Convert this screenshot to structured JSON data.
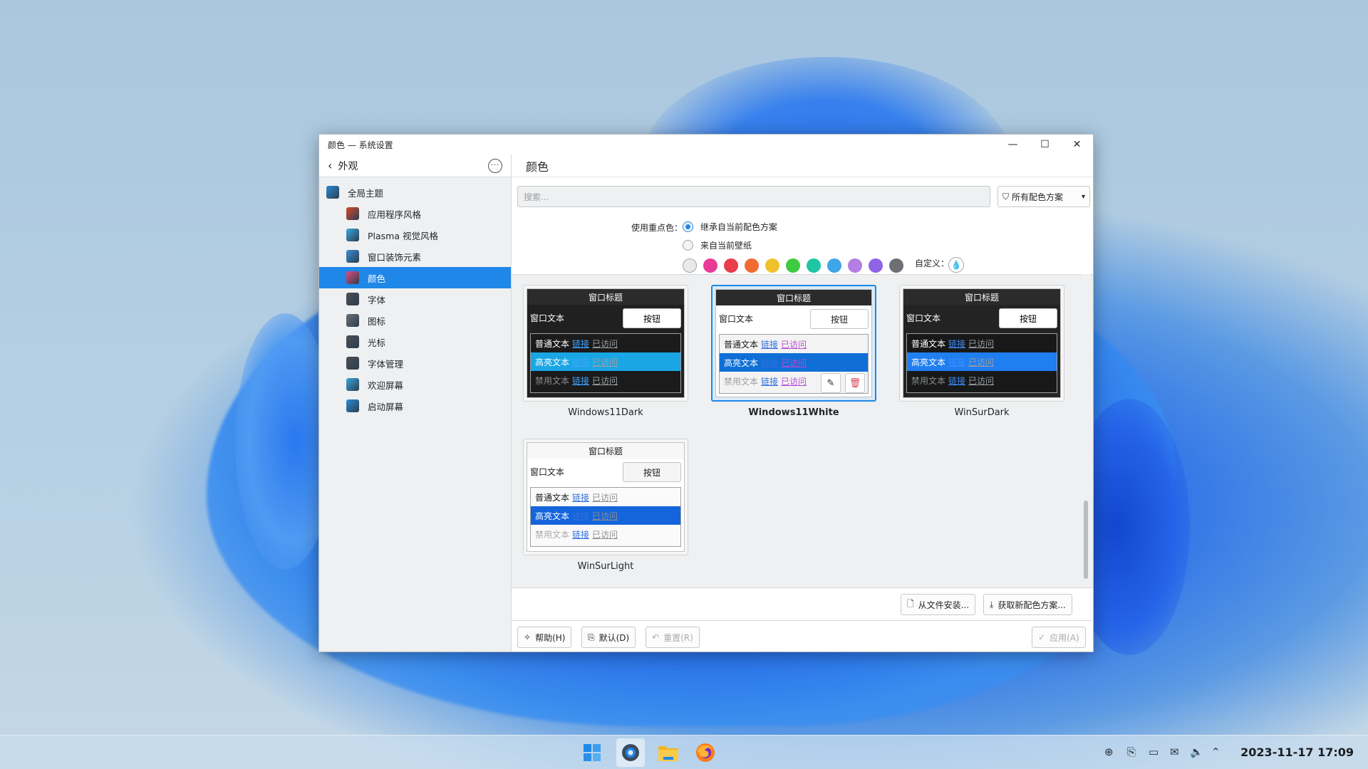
{
  "window": {
    "title": "颜色 — 系统设置",
    "controls": {
      "minimize": "—",
      "maximize": "☐",
      "close": "✕"
    }
  },
  "sidebar": {
    "back_label": "外观",
    "items": [
      {
        "label": "全局主题",
        "icon": "global-theme-icon",
        "color": "#2a8bd6"
      },
      {
        "label": "应用程序风格",
        "icon": "app-style-icon",
        "color": "#d9482b"
      },
      {
        "label": "Plasma 视觉风格",
        "icon": "plasma-style-icon",
        "color": "#3ba7e0"
      },
      {
        "label": "窗口装饰元素",
        "icon": "window-decoration-icon",
        "color": "#3c8fd8"
      },
      {
        "label": "颜色",
        "icon": "colors-icon",
        "color": "#e24a7c"
      },
      {
        "label": "字体",
        "icon": "fonts-icon",
        "color": "#4d4f52"
      },
      {
        "label": "图标",
        "icon": "icons-icon",
        "color": "#6b6f73"
      },
      {
        "label": "光标",
        "icon": "cursor-icon",
        "color": "#4d4f52"
      },
      {
        "label": "字体管理",
        "icon": "font-management-icon",
        "color": "#4d4f52"
      },
      {
        "label": "欢迎屏幕",
        "icon": "splash-screen-icon",
        "color": "#3ba7e0"
      },
      {
        "label": "启动屏幕",
        "icon": "login-screen-icon",
        "color": "#2a8bd6"
      }
    ]
  },
  "main": {
    "title": "颜色",
    "search_placeholder": "搜索...",
    "filter_label": "所有配色方案",
    "accent_label": "使用重点色：",
    "accent_options": [
      "继承自当前配色方案",
      "来自当前壁纸"
    ],
    "custom_label": "自定义：",
    "swatches": [
      "#e8e9ea",
      "#e93a96",
      "#e93c4c",
      "#f06a31",
      "#efc22b",
      "#3fcb41",
      "#1dc7a5",
      "#3ea5e8",
      "#b47ee3",
      "#8f63e6",
      "#6d6f72"
    ]
  },
  "schemes": [
    {
      "name": "Windows11Dark",
      "title": "窗口标题",
      "window_text": "窗口文本",
      "button": "按钮",
      "normal": "普通文本",
      "link": "链接",
      "visited": "已访问",
      "highlight": "高亮文本",
      "disabled": "禁用文本",
      "colors": {
        "title_bg": "#2b2b2b",
        "title_fg": "#ffffff",
        "win_bg": "#202020",
        "win_fg": "#ffffff",
        "btn_bg": "#ffffff",
        "btn_fg": "#000000",
        "view_bg": "#1b1b1b",
        "view_fg": "#ffffff",
        "hl_bg": "#1aa6e4",
        "hl_fg": "#ffffff",
        "link": "#3ea5ff",
        "visited": "#9aa0a6",
        "dis": "#8a8e92"
      }
    },
    {
      "name": "Windows11White",
      "title": "窗口标题",
      "window_text": "窗口文本",
      "button": "按钮",
      "normal": "普通文本",
      "link": "链接",
      "visited": "已访问",
      "highlight": "高亮文本",
      "disabled": "禁用文本",
      "colors": {
        "title_bg": "#2b2b2b",
        "title_fg": "#ffffff",
        "win_bg": "#ffffff",
        "win_fg": "#1a1a1a",
        "btn_bg": "#ffffff",
        "btn_fg": "#1a1a1a",
        "view_bg": "#f3f3f3",
        "view_fg": "#1a1a1a",
        "hl_bg": "#0f6fd6",
        "hl_fg": "#ffffff",
        "link": "#2f6fdc",
        "visited": "#b64bd6",
        "dis": "#9a9ea2"
      }
    },
    {
      "name": "WinSurDark",
      "title": "窗口标题",
      "window_text": "窗口文本",
      "button": "按钮",
      "normal": "普通文本",
      "link": "链接",
      "visited": "已访问",
      "highlight": "高亮文本",
      "disabled": "禁用文本",
      "colors": {
        "title_bg": "#2b2b2b",
        "title_fg": "#ffffff",
        "win_bg": "#232323",
        "win_fg": "#ffffff",
        "btn_bg": "#ffffff",
        "btn_fg": "#000000",
        "view_bg": "#181818",
        "view_fg": "#ffffff",
        "hl_bg": "#1f7ef0",
        "hl_fg": "#ffffff",
        "link": "#3e8dff",
        "visited": "#9aa0a6",
        "dis": "#8a8e92"
      }
    },
    {
      "name": "WinSurLight",
      "title": "窗口标题",
      "window_text": "窗口文本",
      "button": "按钮",
      "normal": "普通文本",
      "link": "链接",
      "visited": "已访问",
      "highlight": "高亮文本",
      "disabled": "禁用文本",
      "colors": {
        "title_bg": "#f7f7f7",
        "title_fg": "#1a1a1a",
        "win_bg": "#ffffff",
        "win_fg": "#1a1a1a",
        "btn_bg": "#f5f5f5",
        "btn_fg": "#1a1a1a",
        "view_bg": "#fafafa",
        "view_fg": "#1a1a1a",
        "hl_bg": "#1465db",
        "hl_fg": "#ffffff",
        "link": "#2f6fdc",
        "visited": "#8a8e92",
        "dis": "#a8abae"
      }
    }
  ],
  "selected_scheme": "Windows11White",
  "footer": {
    "install_label": "从文件安装...",
    "get_new_label": "获取新配色方案...",
    "help_label": "帮助(H)",
    "default_label": "默认(D)",
    "reset_label": "重置(R)",
    "apply_label": "应用(A)"
  },
  "taskbar": {
    "clock": "2023-11-17 17:09",
    "apps": [
      "start-menu-icon",
      "system-settings-icon",
      "file-manager-icon",
      "firefox-icon"
    ]
  }
}
